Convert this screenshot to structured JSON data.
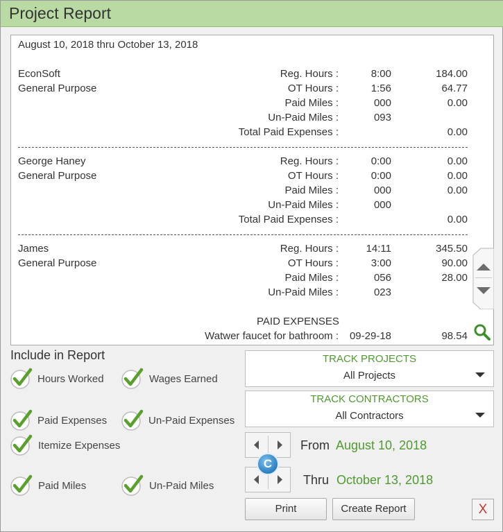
{
  "window": {
    "title": "Project Report"
  },
  "report": {
    "date_range": "August 10, 2018  thru  October 13, 2018",
    "sections": [
      {
        "name": "EconSoft",
        "project": "General Purpose",
        "rows": [
          {
            "label": "Reg. Hours :",
            "v1": "8:00",
            "v2": "184.00"
          },
          {
            "label": "OT Hours :",
            "v1": "1:56",
            "v2": "64.77"
          },
          {
            "label": "Paid Miles :",
            "v1": "000",
            "v2": "0.00"
          },
          {
            "label": "Un-Paid Miles :",
            "v1": "093",
            "v2": ""
          },
          {
            "label": "Total Paid Expenses :",
            "v1": "",
            "v2": "0.00"
          }
        ]
      },
      {
        "name": "George Haney",
        "project": "General Purpose",
        "rows": [
          {
            "label": "Reg. Hours :",
            "v1": "0:00",
            "v2": "0.00"
          },
          {
            "label": "OT Hours :",
            "v1": "0:00",
            "v2": "0.00"
          },
          {
            "label": "Paid Miles :",
            "v1": "000",
            "v2": "0.00"
          },
          {
            "label": "Un-Paid Miles :",
            "v1": "000",
            "v2": ""
          },
          {
            "label": "Total Paid Expenses :",
            "v1": "",
            "v2": "0.00"
          }
        ]
      },
      {
        "name": "James",
        "project": "General Purpose",
        "rows": [
          {
            "label": "Reg. Hours :",
            "v1": "14:11",
            "v2": "345.50"
          },
          {
            "label": "OT Hours :",
            "v1": "3:00",
            "v2": "90.00"
          },
          {
            "label": "Paid Miles :",
            "v1": "056",
            "v2": "28.00"
          },
          {
            "label": "Un-Paid Miles :",
            "v1": "023",
            "v2": ""
          }
        ]
      }
    ],
    "paid_expenses_heading": "PAID EXPENSES",
    "expense": {
      "label": "Watwer faucet for bathroom :",
      "date": "09-29-18",
      "amount": "98.54"
    }
  },
  "include": {
    "heading": "Include in Report",
    "options": {
      "hours_worked": "Hours Worked",
      "wages_earned": "Wages Earned",
      "paid_expenses": "Paid Expenses",
      "unpaid_expenses": "Un-Paid Expenses",
      "itemize_expenses": "Itemize Expenses",
      "paid_miles": "Paid Miles",
      "unpaid_miles": "Un-Paid Miles"
    }
  },
  "track_projects": {
    "heading": "TRACK PROJECTS",
    "value": "All Projects"
  },
  "track_contractors": {
    "heading": "TRACK CONTRACTORS",
    "value": "All Contractors"
  },
  "range": {
    "from_label": "From",
    "from_date": "August 10, 2018",
    "thru_label": "Thru",
    "thru_date": "October 13, 2018",
    "c_label": "C"
  },
  "buttons": {
    "print": "Print",
    "create_report": "Create Report",
    "close": "X"
  },
  "colors": {
    "accent_green": "#4f9a2f",
    "titlebar": "#b9dba3",
    "check_green": "#5aa02c"
  }
}
